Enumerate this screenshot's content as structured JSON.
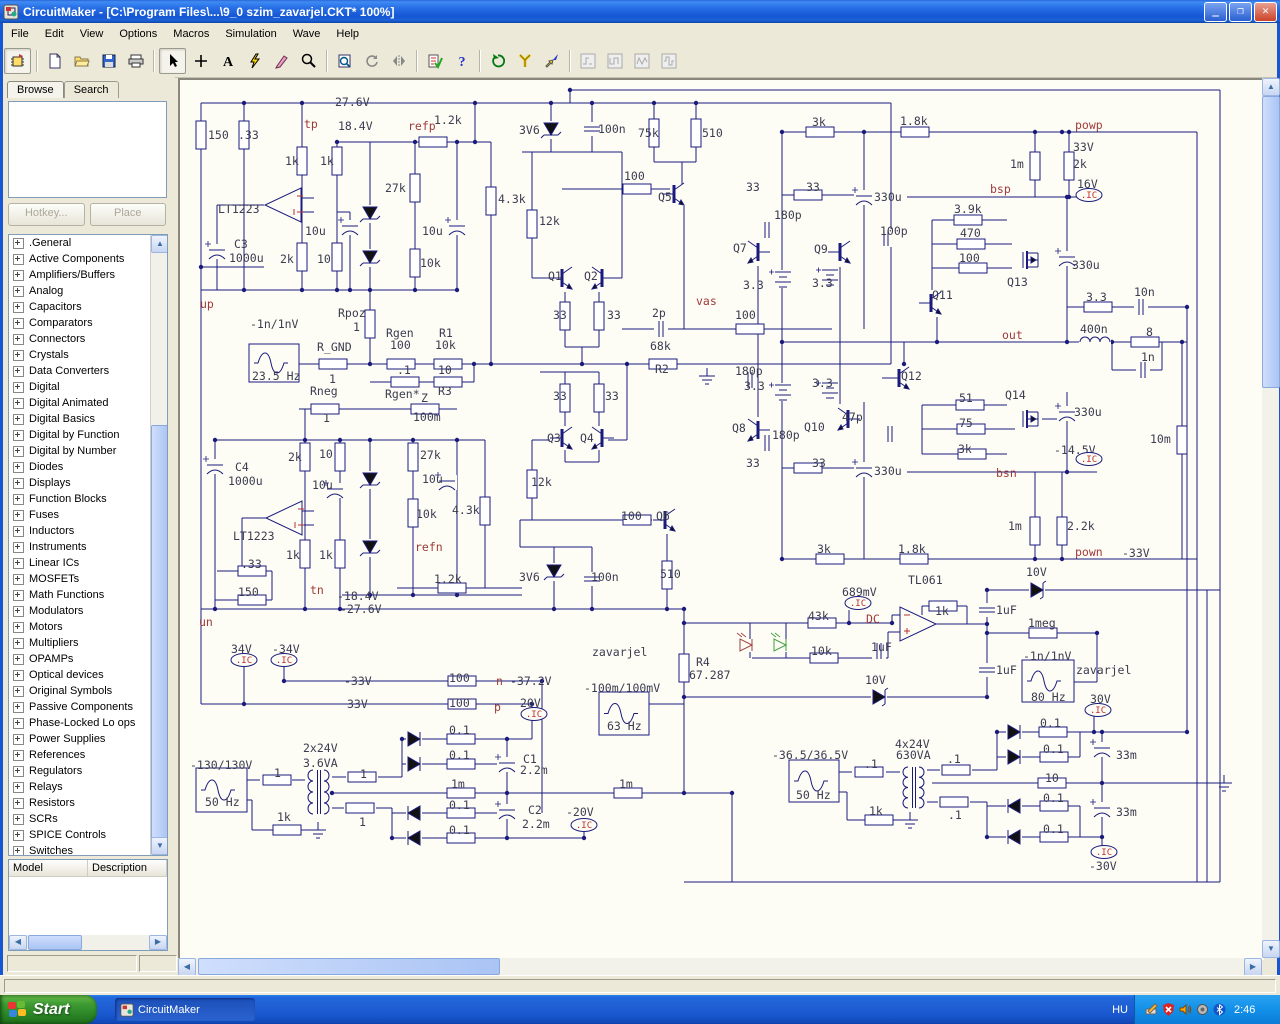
{
  "window": {
    "title": "CircuitMaker - [C:\\Program Files\\...\\9_0 szim_zavarjel.CKT* 100%]"
  },
  "menu": {
    "items": [
      "File",
      "Edit",
      "View",
      "Options",
      "Macros",
      "Simulation",
      "Wave",
      "Help"
    ]
  },
  "toolbar": {
    "buttons": [
      "browse-chip",
      "new",
      "open",
      "save",
      "print",
      "cursor",
      "wire-plus",
      "text-tool",
      "delete-lightning",
      "probe-pen",
      "zoom",
      "zoom-window",
      "rotate",
      "mirror",
      "simulation-check",
      "help",
      "reset",
      "utility-wrench",
      "probe-arrow",
      "scope-1",
      "scope-2",
      "scope-3",
      "scope-4"
    ]
  },
  "sidebar": {
    "tabs": [
      "Browse",
      "Search"
    ],
    "hotkey_label": "Hotkey...",
    "place_label": "Place",
    "model_headers": [
      "Model",
      "Description"
    ],
    "categories": [
      ".General",
      "Active Components",
      "Amplifiers/Buffers",
      "Analog",
      "Capacitors",
      "Comparators",
      "Connectors",
      "Crystals",
      "Data Converters",
      "Digital",
      "Digital Animated",
      "Digital Basics",
      "Digital by Function",
      "Digital by Number",
      "Diodes",
      "Displays",
      "Function Blocks",
      "Fuses",
      "Inductors",
      "Instruments",
      "Linear ICs",
      "MOSFETs",
      "Math Functions",
      "Modulators",
      "Motors",
      "Multipliers",
      "OPAMPs",
      "Optical devices",
      "Original Symbols",
      "Passive Components",
      "Phase-Locked Lo ops",
      "Power Supplies",
      "References",
      "Regulators",
      "Relays",
      "Resistors",
      "SCRs",
      "SPICE Controls",
      "Switches"
    ]
  },
  "taskbar": {
    "start": "Start",
    "task": "CircuitMaker",
    "lang": "HU",
    "time": "2:46"
  },
  "schematic": {
    "labels": [
      [
        "27.6V",
        333,
        104
      ],
      [
        "tp",
        302,
        126,
        "n"
      ],
      [
        "18.4V",
        336,
        128
      ],
      [
        "refp",
        406,
        128,
        "n"
      ],
      [
        "1.2k",
        432,
        122
      ],
      [
        "150",
        206,
        137
      ],
      [
        ".33",
        236,
        137
      ],
      [
        "1k",
        283,
        163
      ],
      [
        "1k",
        318,
        163
      ],
      [
        "27k",
        383,
        190
      ],
      [
        "LT1223",
        216,
        211
      ],
      [
        "10u",
        303,
        233
      ],
      [
        "10u",
        420,
        233
      ],
      [
        "C3",
        232,
        246
      ],
      [
        "1000u",
        227,
        260
      ],
      [
        "2k",
        278,
        261
      ],
      [
        "10",
        315,
        261
      ],
      [
        "10k",
        418,
        265
      ],
      [
        "up",
        198,
        306,
        "n"
      ],
      [
        "4.3k",
        496,
        201
      ],
      [
        "3V6",
        517,
        132
      ],
      [
        "100n",
        596,
        131
      ],
      [
        "75k",
        636,
        135
      ],
      [
        "510",
        700,
        135
      ],
      [
        "100",
        622,
        178
      ],
      [
        "Q5",
        656,
        199
      ],
      [
        "12k",
        537,
        223
      ],
      [
        "Q1",
        546,
        278
      ],
      [
        "Q2",
        582,
        278
      ],
      [
        "33",
        551,
        317
      ],
      [
        "33",
        605,
        317
      ],
      [
        "3k",
        810,
        124
      ],
      [
        "1.8k",
        898,
        123
      ],
      [
        "powp",
        1073,
        127,
        "n"
      ],
      [
        "33V",
        1071,
        149
      ],
      [
        "1m",
        1008,
        166
      ],
      [
        "2k",
        1071,
        166
      ],
      [
        "33",
        744,
        189
      ],
      [
        "33",
        804,
        189
      ],
      [
        "180p",
        772,
        217
      ],
      [
        "330u",
        872,
        199
      ],
      [
        "bsp",
        988,
        191,
        "n"
      ],
      [
        "16V",
        1075,
        186
      ],
      [
        ".IC",
        1087,
        196,
        "i"
      ],
      [
        "100p",
        878,
        233
      ],
      [
        "3.9k",
        952,
        211
      ],
      [
        "470",
        958,
        235
      ],
      [
        "100",
        957,
        260
      ],
      [
        "Q7",
        731,
        250
      ],
      [
        "Q9",
        812,
        251
      ],
      [
        "Q13",
        1005,
        284
      ],
      [
        "3.3",
        741,
        287
      ],
      [
        "3.3",
        810,
        285
      ],
      [
        "Q11",
        930,
        297
      ],
      [
        "330u",
        1070,
        267
      ],
      [
        "3.3",
        1084,
        299
      ],
      [
        "10n",
        1132,
        294
      ],
      [
        "400n",
        1078,
        331
      ],
      [
        "8",
        1144,
        334
      ],
      [
        "1n",
        1139,
        359
      ],
      [
        "out",
        1000,
        337,
        "n"
      ],
      [
        "vas",
        694,
        303,
        "n"
      ],
      [
        "100",
        733,
        317
      ],
      [
        "2p",
        650,
        315
      ],
      [
        "68k",
        648,
        348
      ],
      [
        "R2",
        653,
        371
      ],
      [
        "180p",
        733,
        373
      ],
      [
        "3.3",
        742,
        388
      ],
      [
        "3.3",
        810,
        385
      ],
      [
        "Q12",
        899,
        378
      ],
      [
        "51",
        957,
        400
      ],
      [
        "Q14",
        1003,
        397
      ],
      [
        "330u",
        1072,
        414
      ],
      [
        "Q8",
        730,
        430
      ],
      [
        "Q10",
        802,
        429
      ],
      [
        "47p",
        840,
        419
      ],
      [
        "75",
        957,
        425
      ],
      [
        "180p",
        770,
        437
      ],
      [
        "3k",
        956,
        451
      ],
      [
        "-14.5V",
        1052,
        452
      ],
      [
        ".IC",
        1087,
        460,
        "i"
      ],
      [
        "33",
        744,
        465
      ],
      [
        "33",
        810,
        465
      ],
      [
        "330u",
        872,
        473
      ],
      [
        "bsn",
        994,
        475,
        "n"
      ],
      [
        "10m",
        1148,
        441
      ],
      [
        "Rpoz",
        336,
        315
      ],
      [
        "1",
        351,
        329
      ],
      [
        "-1n/1nV",
        248,
        326
      ],
      [
        "R_GND",
        315,
        349
      ],
      [
        "Rgen",
        384,
        335
      ],
      [
        "100",
        388,
        347
      ],
      [
        "R1",
        437,
        335
      ],
      [
        "10k",
        433,
        347
      ],
      [
        "23.5 Hz",
        250,
        378
      ],
      [
        "1",
        327,
        381
      ],
      [
        ".1",
        395,
        372
      ],
      [
        "10",
        436,
        372
      ],
      [
        "Rneg",
        308,
        393
      ],
      [
        "Rgen*",
        383,
        396
      ],
      [
        "Z",
        419,
        400
      ],
      [
        "R3",
        436,
        393
      ],
      [
        "1",
        321,
        420
      ],
      [
        "100m",
        411,
        419
      ],
      [
        "C4",
        233,
        469
      ],
      [
        "1000u",
        226,
        483
      ],
      [
        "2k",
        286,
        459
      ],
      [
        "10",
        317,
        456
      ],
      [
        "27k",
        418,
        457
      ],
      [
        "10u",
        310,
        487
      ],
      [
        "10u",
        420,
        481
      ],
      [
        "10k",
        414,
        516
      ],
      [
        "4.3k",
        450,
        512
      ],
      [
        "LT1223",
        231,
        538
      ],
      [
        "1k",
        284,
        557
      ],
      [
        "1k",
        317,
        557
      ],
      [
        "refn",
        413,
        549,
        "n"
      ],
      [
        ".33",
        239,
        566
      ],
      [
        "150",
        236,
        594
      ],
      [
        "tn",
        308,
        592,
        "n"
      ],
      [
        "-18.4V",
        335,
        598
      ],
      [
        "-27.6V",
        338,
        611
      ],
      [
        "1.2k",
        432,
        581
      ],
      [
        "un",
        197,
        624,
        "n"
      ],
      [
        "34V",
        229,
        651
      ],
      [
        ".IC",
        242,
        661,
        "i"
      ],
      [
        "-34V",
        270,
        651
      ],
      [
        ".IC",
        282,
        661,
        "i"
      ],
      [
        "-33V",
        342,
        683
      ],
      [
        "100",
        447,
        680
      ],
      [
        "n",
        494,
        683,
        "n"
      ],
      [
        "-37.2V",
        508,
        683
      ],
      [
        "33V",
        345,
        706
      ],
      [
        "100",
        447,
        705
      ],
      [
        "p",
        492,
        709,
        "n"
      ],
      [
        "20V",
        518,
        705
      ],
      [
        ".IC",
        532,
        715,
        "i"
      ],
      [
        "zavarjel",
        590,
        654
      ],
      [
        "R4",
        694,
        664
      ],
      [
        "67.287",
        687,
        677
      ],
      [
        "-100m/100mV",
        582,
        690
      ],
      [
        "63 Hz",
        605,
        728
      ],
      [
        "689mV",
        840,
        594
      ],
      [
        ".IC",
        856,
        604,
        "i"
      ],
      [
        "DC",
        864,
        621,
        "n"
      ],
      [
        "43k",
        806,
        618
      ],
      [
        "10k",
        809,
        653
      ],
      [
        "1uF",
        869,
        649
      ],
      [
        "TL061",
        906,
        582
      ],
      [
        "1k",
        933,
        613
      ],
      [
        "1uF",
        994,
        612
      ],
      [
        "10V",
        1024,
        574
      ],
      [
        "1meg",
        1026,
        625
      ],
      [
        "1uF",
        994,
        672
      ],
      [
        "-1n/1nV",
        1021,
        658
      ],
      [
        "zavarjel",
        1074,
        672
      ],
      [
        "80 Hz",
        1029,
        699
      ],
      [
        "10V",
        863,
        682
      ],
      [
        "1m",
        1006,
        528
      ],
      [
        "2.2k",
        1065,
        528
      ],
      [
        "pown",
        1073,
        554,
        "n"
      ],
      [
        "-33V",
        1120,
        555
      ],
      [
        "3k",
        815,
        551
      ],
      [
        "1.8k",
        896,
        551
      ],
      [
        "-130/130V",
        188,
        767
      ],
      [
        "50 Hz",
        203,
        804
      ],
      [
        "1",
        272,
        775
      ],
      [
        "2x24V",
        301,
        750
      ],
      [
        "3.6VA",
        301,
        765
      ],
      [
        "1",
        358,
        776
      ],
      [
        "1",
        357,
        824
      ],
      [
        "1k",
        275,
        819
      ],
      [
        "0.1",
        447,
        732
      ],
      [
        "0.1",
        447,
        757
      ],
      [
        "1m",
        449,
        786
      ],
      [
        "0.1",
        447,
        807
      ],
      [
        "0.1",
        447,
        832
      ],
      [
        "C1",
        521,
        761
      ],
      [
        "2.2m",
        518,
        772
      ],
      [
        "C2",
        526,
        812
      ],
      [
        "2.2m",
        520,
        826
      ],
      [
        "-20V",
        564,
        814
      ],
      [
        ".IC",
        582,
        826,
        "i"
      ],
      [
        "1m",
        617,
        786
      ],
      [
        "-36.5/36.5V",
        770,
        757
      ],
      [
        "50 Hz",
        794,
        797
      ],
      [
        ".1",
        862,
        766
      ],
      [
        "4x24V",
        893,
        746
      ],
      [
        "630VA",
        894,
        757
      ],
      [
        ".1",
        945,
        761
      ],
      [
        ".1",
        946,
        817
      ],
      [
        "1k",
        867,
        813
      ],
      [
        "0.1",
        1038,
        725
      ],
      [
        "0.1",
        1041,
        751
      ],
      [
        "10",
        1043,
        780
      ],
      [
        "0.1",
        1041,
        800
      ],
      [
        "0.1",
        1041,
        831
      ],
      [
        "33m",
        1114,
        757
      ],
      [
        "33m",
        1114,
        814
      ],
      [
        "30V",
        1088,
        701
      ],
      [
        ".IC",
        1096,
        711,
        "i"
      ],
      [
        ".IC",
        1102,
        853,
        "i"
      ],
      [
        "-30V",
        1087,
        868
      ],
      [
        "100n",
        589,
        579
      ],
      [
        "510",
        658,
        576
      ],
      [
        "3V6",
        517,
        579
      ],
      [
        "12k",
        529,
        484
      ],
      [
        "33",
        551,
        398
      ],
      [
        "33",
        603,
        398
      ],
      [
        "Q3",
        545,
        440
      ],
      [
        "Q4",
        578,
        440
      ],
      [
        "100",
        619,
        518
      ],
      [
        "Q6",
        654,
        518
      ]
    ]
  }
}
